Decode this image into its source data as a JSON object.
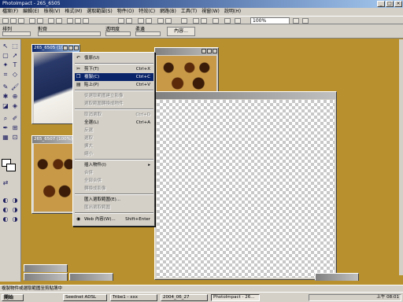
{
  "app": {
    "title": "PhotoImpact - 265_6505"
  },
  "menubar": [
    "檔案(F)",
    "編輯(E)",
    "檢視(V)",
    "格式(M)",
    "選取範圍(S)",
    "物件(O)",
    "特效(C)",
    "網路(B)",
    "工具(T)",
    "視窗(W)",
    "說明(H)"
  ],
  "toolbar": {
    "zoom": "100%"
  },
  "attrbar": {
    "labels": [
      "排列",
      "對齊",
      "透明度",
      "柔邊"
    ],
    "button": "內容..."
  },
  "documents": [
    {
      "title": "265_6505 (100%) 235x176",
      "active": true
    },
    {
      "title": "265_6507 (100%)",
      "active": false
    }
  ],
  "context_menu": {
    "items": [
      {
        "label": "復原(U)",
        "shortcut": "",
        "disabled": false,
        "icon": "undo-icon",
        "glyph": "↶"
      },
      {
        "label": "剪下(T)",
        "shortcut": "Ctrl+X",
        "disabled": false,
        "icon": "scissors-icon",
        "glyph": "✂"
      },
      {
        "label": "複製(C)",
        "shortcut": "Ctrl+C",
        "disabled": false,
        "selected": true,
        "icon": "copy-icon",
        "glyph": "❐"
      },
      {
        "label": "貼上(P)",
        "shortcut": "Ctrl+V",
        "disabled": false,
        "icon": "paste-icon",
        "glyph": "▤"
      },
      {
        "label": "從選取範圍建立影像",
        "shortcut": "",
        "disabled": true
      },
      {
        "label": "選取範圍轉換成物件",
        "shortcut": "",
        "disabled": true
      },
      {
        "label": "取消選取",
        "shortcut": "Ctrl+D",
        "disabled": true
      },
      {
        "label": "全選(L)",
        "shortcut": "Ctrl+A",
        "disabled": false
      },
      {
        "label": "反選",
        "shortcut": "",
        "disabled": true
      },
      {
        "label": "選取",
        "shortcut": "",
        "disabled": true
      },
      {
        "label": "擴大",
        "shortcut": "",
        "disabled": true
      },
      {
        "label": "縮小",
        "shortcut": "",
        "disabled": true
      },
      {
        "label": "插入物件(I)",
        "shortcut": "▸",
        "disabled": false
      },
      {
        "label": "合併",
        "shortcut": "",
        "disabled": true
      },
      {
        "label": "全部合併",
        "shortcut": "",
        "disabled": true
      },
      {
        "label": "轉換成影像",
        "shortcut": "",
        "disabled": true
      },
      {
        "label": "匯入選取範圍(E)...",
        "shortcut": "",
        "disabled": false
      },
      {
        "label": "匯出選取範圍",
        "shortcut": "",
        "disabled": true
      },
      {
        "label": "Web 內容(W)...",
        "shortcut": "Shift+Enter",
        "disabled": false,
        "icon": "web-icon",
        "glyph": "◉"
      }
    ]
  },
  "statusbar": {
    "text": "複製物件或選取範圍至剪貼簿中"
  },
  "taskbar": {
    "start": "開始",
    "tasks": [
      "Seednet ADSL",
      "Tribe1 - xxx",
      "2004_06_27",
      "PhotoImpact - 26..."
    ],
    "clock": "上午 08:01"
  }
}
